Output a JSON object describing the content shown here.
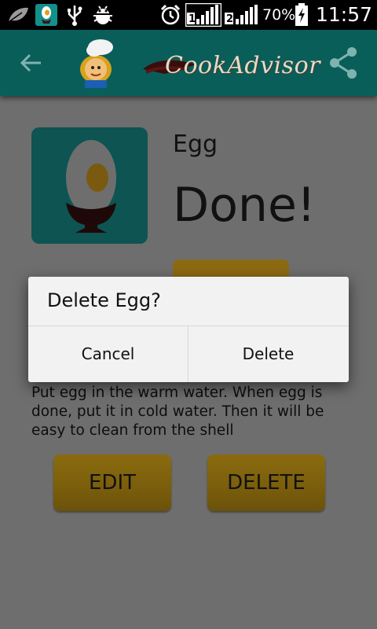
{
  "status_bar": {
    "battery_percent": "70%",
    "time": "11:57",
    "sim1_label": "1",
    "sim2_label": "2",
    "icons": [
      "leaf-icon",
      "app-notification-icon",
      "usb-icon",
      "android-debug-icon",
      "alarm-icon",
      "signal-sim1-icon",
      "signal-sim2-icon",
      "battery-charging-icon"
    ]
  },
  "app_bar": {
    "logo_text": "CookAdvisor",
    "back_icon": "arrow-back-icon",
    "share_icon": "share-icon",
    "color": "#0a5e5a"
  },
  "recipe": {
    "name": "Egg",
    "status": "Done!",
    "instructions": "Put egg in the warm water. When egg is done, put it in cold water. Then it will be easy to clean from the shell",
    "edit_label": "EDIT",
    "delete_label": "DELETE",
    "image_icon": "egg-cup-icon"
  },
  "dialog": {
    "title": "Delete Egg?",
    "cancel_label": "Cancel",
    "delete_label": "Delete"
  },
  "colors": {
    "accent_gold": "#e6b11c",
    "teal": "#0d8f8a",
    "overlay_dim": "rgba(0,0,0,0.55)"
  }
}
